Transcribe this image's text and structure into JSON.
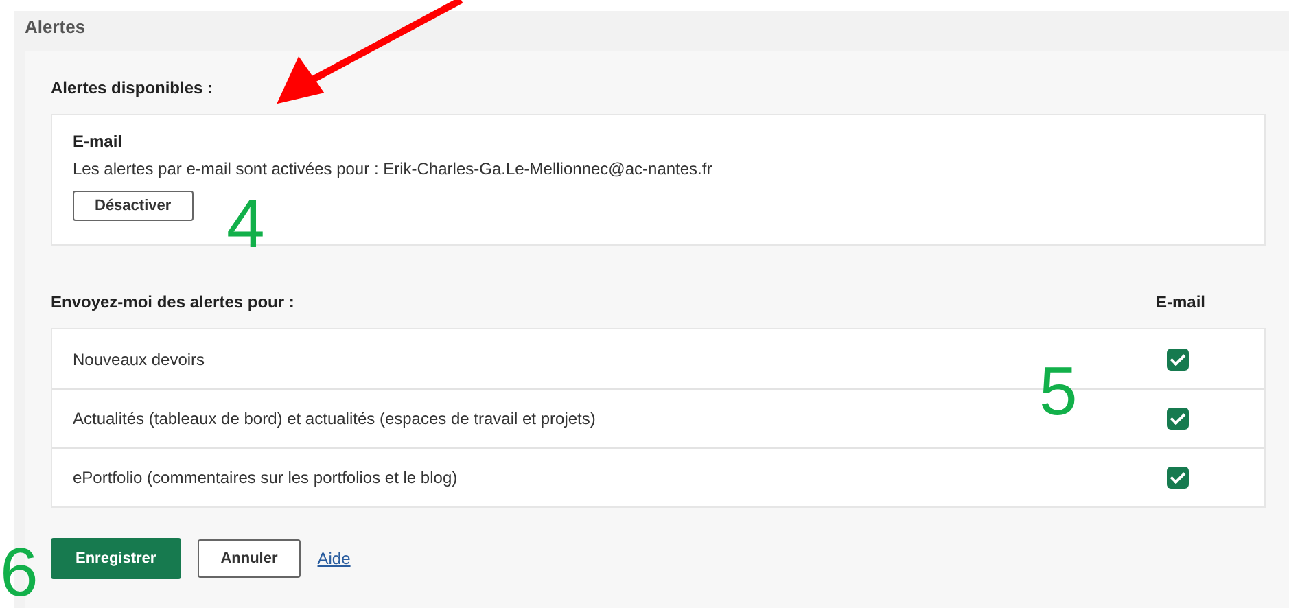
{
  "section": {
    "title": "Alertes"
  },
  "available": {
    "heading": "Alertes disponibles :",
    "channel": {
      "title": "E-mail",
      "description": "Les alertes par e-mail sont activées pour : Erik-Charles-Ga.Le-Mellionnec@ac-nantes.fr",
      "button": "Désactiver"
    }
  },
  "preferences": {
    "heading": "Envoyez-moi des alertes pour :",
    "column": "E-mail",
    "rows": [
      {
        "label": "Nouveaux devoirs",
        "checked": true
      },
      {
        "label": "Actualités (tableaux de bord) et actualités (espaces de travail et projets)",
        "checked": true
      },
      {
        "label": "ePortfolio (commentaires sur les portfolios et le blog)",
        "checked": true
      }
    ]
  },
  "buttons": [
    {
      "label": "Enregistrer",
      "kind": "primary"
    },
    {
      "label": "Annuler",
      "kind": "secondary"
    },
    {
      "label": "Aide",
      "kind": "link"
    }
  ],
  "annotations": [
    {
      "text": "4"
    },
    {
      "text": "5"
    },
    {
      "text": "6"
    }
  ]
}
